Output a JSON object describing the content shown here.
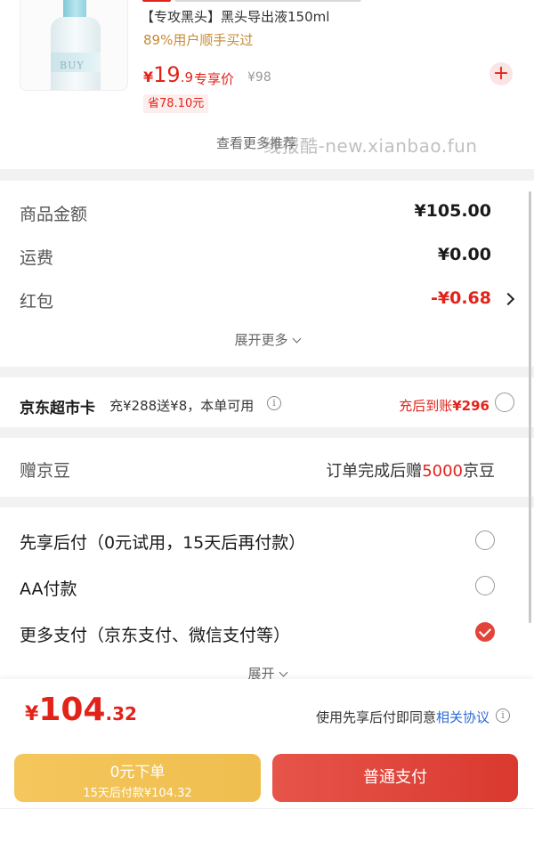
{
  "product": {
    "name": "【专攻黑头】黑头导出液150ml",
    "bought": "89%用户顺手买过",
    "price_symbol": "¥",
    "price_int": "19",
    "price_dec": ".9",
    "price_tag": "专享价",
    "original_price": "¥98",
    "save": "省78.10元",
    "add_symbol": "+",
    "bottle_label": "BUY",
    "more_recommend": "查看更多推荐",
    "watermark": "线报酷-new.xianbao.fun"
  },
  "summary": {
    "rows": [
      {
        "label": "商品金额",
        "value": "¥105.00"
      },
      {
        "label": "运费",
        "value": "¥0.00"
      },
      {
        "label": "红包",
        "value": "-¥0.68"
      }
    ],
    "expand_more": "展开更多"
  },
  "supermarket_card": {
    "title": "京东超市卡",
    "desc": "充¥288送¥8，本单可用",
    "info_symbol": "i",
    "right_prefix": "充后到账",
    "right_amount": "¥296"
  },
  "beans": {
    "label": "赠京豆",
    "prefix": "订单完成后赠",
    "amount": "5000",
    "suffix": "京豆"
  },
  "payment": {
    "options": [
      {
        "label": "先享后付（0元试用，15天后再付款）",
        "checked": false
      },
      {
        "label": "AA付款",
        "checked": false
      },
      {
        "label": "更多支付（京东支付、微信支付等）",
        "checked": true
      }
    ],
    "expand": "展开"
  },
  "bottom_bar": {
    "total_symbol": "¥",
    "total_int": "104",
    "total_dec": ".32",
    "agree_prefix": "使用先享后付即同意",
    "agree_link": "相关协议",
    "info_symbol": "i",
    "zero_button_main": "0元下单",
    "zero_button_sub": "15天后付款¥104.32",
    "pay_button": "普通支付"
  },
  "colors": {
    "accent_red": "#e2231a",
    "gold_button": "#f4c65c",
    "pay_button": "#e7544a",
    "link_blue": "#2f6bd6",
    "bought_gold": "#c78a33"
  }
}
